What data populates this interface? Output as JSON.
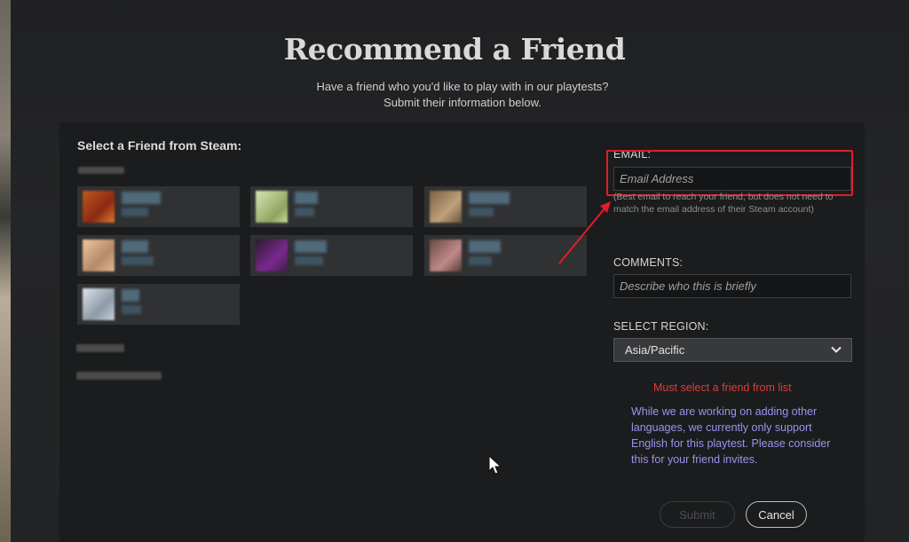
{
  "header": {
    "title": "Recommend a Friend",
    "subtitle_line1": "Have a friend who you'd like to play with in our playtests?",
    "subtitle_line2": "Submit their information below."
  },
  "friends": {
    "heading": "Select a Friend from Steam:"
  },
  "form": {
    "email_label": "EMAIL:",
    "email_placeholder": "Email Address",
    "email_help": "(Best email to reach your friend, but does not need to match the email address of their Steam account)",
    "comments_label": "COMMENTS:",
    "comments_placeholder": "Describe who this is briefly",
    "region_label": "SELECT REGION:",
    "region_value": "Asia/Pacific",
    "error": "Must select a friend from list",
    "notice": "While we are working on adding other languages, we currently only support English for this playtest. Please consider this for your friend invites.",
    "submit_label": "Submit",
    "cancel_label": "Cancel"
  },
  "colors": {
    "highlight": "#e21d2a",
    "error": "#e23b3b",
    "notice": "#9d92f0"
  },
  "icons": {
    "dropdown": "chevron-down-icon",
    "cursor": "mouse-cursor-icon"
  }
}
